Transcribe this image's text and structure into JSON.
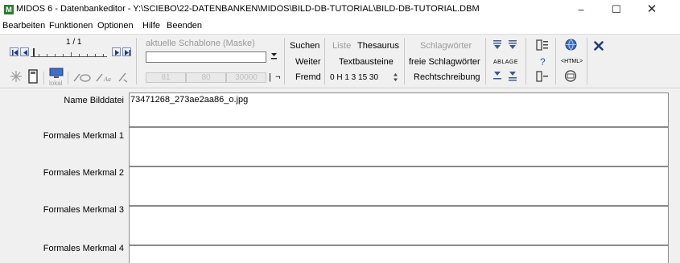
{
  "window": {
    "logo_letter": "M",
    "title": "MIDOS 6 - Datenbankeditor - Y:\\SCIEBO\\22-DATENBANKEN\\MIDOS\\BILD-DB-TUTORIAL\\BILD-DB-TUTORIAL.DBM",
    "minimize": "–",
    "maximize": "☐",
    "close": "✕"
  },
  "menu": [
    "Bearbeiten",
    "Funktionen",
    "Optionen",
    "Hilfe",
    "Beenden"
  ],
  "navigator": {
    "record_position": "1 / 1",
    "lokal_label": "lokal"
  },
  "template": {
    "label": "aktuelle Schablone (Maske)",
    "value": "",
    "counters": [
      "81",
      "80",
      "30000"
    ],
    "separator": "|",
    "extra": "¬"
  },
  "search": {
    "suchen": "Suchen",
    "weiter": "Weiter",
    "fremd": "Fremd"
  },
  "lists": {
    "liste": "Liste",
    "thesaurus": "Thesaurus",
    "textbausteine": "Textbausteine",
    "digits": "0 H 1 3 15 30"
  },
  "keywords": {
    "schlagwoerter": "Schlagwörter",
    "freie": "freie Schlagwörter",
    "rechtschreibung": "Rechtschreibung"
  },
  "ablage": {
    "label": "ABLAGE"
  },
  "html_tools": {
    "help_mark": "?",
    "html_label": "<HTML>"
  },
  "fields": [
    {
      "label": "Name Bilddatei",
      "value": "73471268_273ae2aa86_o.jpg"
    },
    {
      "label": "Formales Merkmal 1",
      "value": ""
    },
    {
      "label": "Formales Merkmal 2",
      "value": ""
    },
    {
      "label": "Formales Merkmal 3",
      "value": ""
    },
    {
      "label": "Formales Merkmal 4",
      "value": ""
    }
  ],
  "colors": {
    "accent_blue": "#2a56a0",
    "close_x": "#1f3e7a",
    "logo_green": "#2e7d32",
    "background": "#f0f0f0"
  }
}
